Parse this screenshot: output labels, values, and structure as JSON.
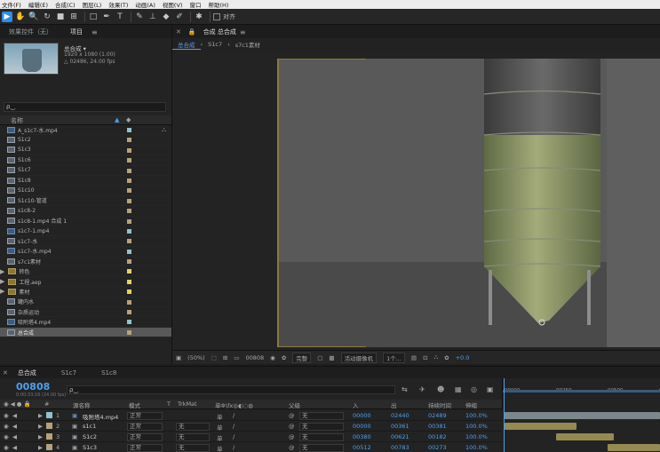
{
  "menu": [
    "文件(F)",
    "编辑(E)",
    "合成(C)",
    "图层(L)",
    "效果(T)",
    "动画(A)",
    "视图(V)",
    "窗口",
    "帮助(H)"
  ],
  "toolbar": {
    "tools": [
      {
        "icon": "selection-tool-icon",
        "glyph": "▶"
      },
      {
        "icon": "hand-tool-icon",
        "glyph": "✋"
      },
      {
        "icon": "zoom-tool-icon",
        "glyph": "🔍"
      },
      {
        "icon": "rotate-tool-icon",
        "glyph": "↻"
      },
      {
        "icon": "camera-tool-icon",
        "glyph": "■"
      },
      {
        "icon": "pan-behind-tool-icon",
        "glyph": "⊞"
      },
      {
        "icon": "rectangle-tool-icon",
        "glyph": "□"
      },
      {
        "icon": "pen-tool-icon",
        "glyph": "✒"
      },
      {
        "icon": "text-tool-icon",
        "glyph": "T"
      },
      {
        "icon": "brush-tool-icon",
        "glyph": "✎"
      },
      {
        "icon": "clone-stamp-tool-icon",
        "glyph": "⊥"
      },
      {
        "icon": "eraser-tool-icon",
        "glyph": "◆"
      },
      {
        "icon": "roto-brush-tool-icon",
        "glyph": "✐"
      },
      {
        "icon": "puppet-tool-icon",
        "glyph": "✱"
      }
    ],
    "snap_label": "对齐"
  },
  "project_panel": {
    "tabs": [
      "效果控件（无）",
      "项目"
    ],
    "comp_name": "总合成 ▾",
    "comp_res": "1920 x 1080 (1.00)",
    "comp_duration": "△ 02486, 24.00 fps",
    "search_placeholder": "ρ‿",
    "col_name": "名称",
    "items": [
      {
        "name": "A_s1c7-水.mp4",
        "type": "footage",
        "color": "#8fc3cf"
      },
      {
        "name": "S1c2",
        "type": "comp",
        "color": "#b7a27a"
      },
      {
        "name": "S1c3",
        "type": "comp",
        "color": "#b7a27a"
      },
      {
        "name": "S1c6",
        "type": "comp",
        "color": "#b7a27a"
      },
      {
        "name": "S1c7",
        "type": "comp",
        "color": "#b7a27a"
      },
      {
        "name": "S1c8",
        "type": "comp",
        "color": "#b7a27a"
      },
      {
        "name": "S1c10",
        "type": "comp",
        "color": "#b7a27a"
      },
      {
        "name": "S1c10-管道",
        "type": "comp",
        "color": "#b7a27a"
      },
      {
        "name": "s1c8-2",
        "type": "comp",
        "color": "#b7a27a"
      },
      {
        "name": "s1c8-1.mp4 合成 1",
        "type": "comp",
        "color": "#b7a27a"
      },
      {
        "name": "s1c7-1.mp4",
        "type": "footage",
        "color": "#8fc3cf"
      },
      {
        "name": "s1c7-水",
        "type": "comp",
        "color": "#b7a27a"
      },
      {
        "name": "s1c7-水.mp4",
        "type": "footage",
        "color": "#8fc3cf"
      },
      {
        "name": "s7c1素材",
        "type": "comp",
        "color": "#b7a27a"
      },
      {
        "name": "转色",
        "type": "folder",
        "color": "#e4d45a"
      },
      {
        "name": "工程.aep",
        "type": "folder",
        "color": "#e4d45a"
      },
      {
        "name": "素材",
        "type": "folder",
        "color": "#e4d45a"
      },
      {
        "name": "罐内水",
        "type": "comp",
        "color": "#b7a27a"
      },
      {
        "name": "杂质运动",
        "type": "comp",
        "color": "#b7a27a"
      },
      {
        "name": "吸附塔4.mp4",
        "type": "footage",
        "color": "#8fc3cf"
      },
      {
        "name": "总合成",
        "type": "comp",
        "color": "#b7a27a",
        "selected": true
      }
    ],
    "bpc": "8bpc"
  },
  "viewer": {
    "tab_title": "合成 总合成",
    "breadcrumbs": [
      "总合成",
      "S1c7",
      "s7c1素材"
    ],
    "zoom": "(50%)",
    "timecode": "00808",
    "resolution": "完整",
    "camera": "活动摄像机",
    "views": "1个...",
    "exposure": "+0.0"
  },
  "timeline": {
    "tabs": [
      "总合成",
      "S1c7",
      "S1c8"
    ],
    "timecode": "00808",
    "fps_info": "0:00:33:16 (24.00 fps)",
    "search_placeholder": "ρ‿",
    "headers": {
      "num": "#",
      "name": "源名称",
      "mode": "模式",
      "t": "T",
      "trkmat": "TrkMat",
      "parent": "父级",
      "in": "入",
      "out": "出",
      "duration": "持续时间",
      "stretch": "伸缩"
    },
    "ruler_ticks": [
      "00000",
      "00250",
      "00500",
      "00750"
    ],
    "layers": [
      {
        "num": "1",
        "name": "吸附塔4.mp4",
        "type": "footage",
        "color": "#8fc3cf",
        "mode": "正常",
        "trkmat": "",
        "parent": "无",
        "in": "00000",
        "out": "02440",
        "duration": "02489",
        "stretch": "100.0%",
        "bar_start": 0.0,
        "bar_end": 1.0,
        "bar_color": "#8a9aa0"
      },
      {
        "num": "2",
        "name": "s1c1",
        "type": "comp",
        "color": "#b7a27a",
        "mode": "正常",
        "trkmat": "无",
        "parent": "无",
        "in": "00000",
        "out": "00361",
        "duration": "00381",
        "stretch": "100.0%",
        "bar_start": 0.0,
        "bar_end": 0.46,
        "bar_color": "#a89c5a"
      },
      {
        "num": "3",
        "name": "S1c2",
        "type": "comp",
        "color": "#b7a27a",
        "mode": "正常",
        "trkmat": "无",
        "parent": "无",
        "in": "00380",
        "out": "00621",
        "duration": "00182",
        "stretch": "100.0%",
        "bar_start": 0.33,
        "bar_end": 0.7,
        "bar_color": "#a89c5a"
      },
      {
        "num": "4",
        "name": "S1c3",
        "type": "comp",
        "color": "#b7a27a",
        "mode": "正常",
        "trkmat": "无",
        "parent": "无",
        "in": "00512",
        "out": "00783",
        "duration": "00273",
        "stretch": "100.0%",
        "bar_start": 0.66,
        "bar_end": 1.0,
        "bar_color": "#a89c5a"
      }
    ]
  }
}
